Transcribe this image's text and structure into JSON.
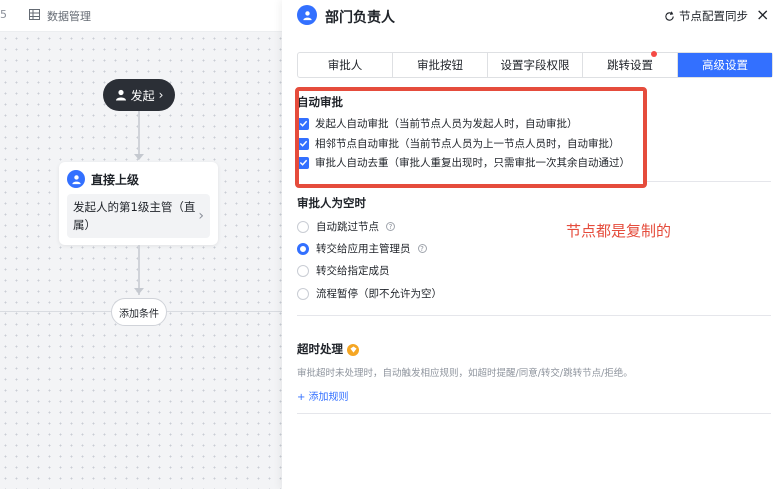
{
  "topbar": {
    "edge_text": "5",
    "data_mgmt": "数据管理"
  },
  "flow": {
    "start_label": "发起",
    "approver_title": "直接上级",
    "approver_desc": "发起人的第1级主管（直属）",
    "add_condition": "添加条件"
  },
  "panel": {
    "title": "部门负责人",
    "sync_label": "节点配置同步",
    "close": "×",
    "tabs": [
      {
        "label": "审批人"
      },
      {
        "label": "审批按钮"
      },
      {
        "label": "设置字段权限"
      },
      {
        "label": "跳转设置"
      },
      {
        "label": "高级设置"
      }
    ],
    "auto_approve": {
      "title": "自动审批",
      "options": [
        "发起人自动审批（当前节点人员为发起人时，自动审批）",
        "相邻节点自动审批（当前节点人员为上一节点人员时，自动审批）",
        "审批人自动去重（审批人重复出现时，只需审批一次其余自动通过）"
      ]
    },
    "empty_approver": {
      "title": "审批人为空时",
      "options": [
        "自动跳过节点",
        "转交给应用主管理员",
        "转交给指定成员",
        "流程暂停（即不允许为空）"
      ],
      "selected_index": 1
    },
    "timeout": {
      "title": "超时处理",
      "desc": "审批超时未处理时，自动触发相应规则，如超时提醒/同意/转交/跳转节点/拒绝。",
      "add_rule": "+ 添加规则"
    },
    "annotation": "节点都是复制的"
  },
  "colors": {
    "accent": "#3370ff",
    "annotation": "#e54c3c",
    "node_dark": "#2b2f36"
  }
}
